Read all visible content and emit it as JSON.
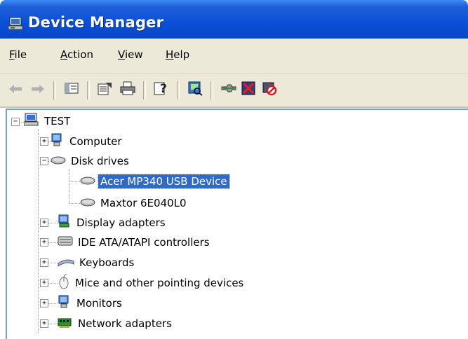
{
  "window": {
    "title": "Device Manager"
  },
  "menu": {
    "items": [
      "File",
      "Action",
      "View",
      "Help"
    ]
  },
  "toolbar": {
    "buttons": [
      "back-arrow-icon",
      "forward-arrow-icon",
      "show-hide-console-tree-icon",
      "properties-icon",
      "print-icon",
      "help-icon",
      "scan-hardware-icon",
      "update-driver-icon",
      "uninstall-icon",
      "disable-icon"
    ]
  },
  "tree": {
    "root": "TEST",
    "nodes": [
      {
        "label": "Computer"
      },
      {
        "label": "Disk drives"
      },
      {
        "label": "Acer  MP340  USB Device"
      },
      {
        "label": "Maxtor 6E040L0"
      },
      {
        "label": "Display adapters"
      },
      {
        "label": "IDE ATA/ATAPI controllers"
      },
      {
        "label": "Keyboards"
      },
      {
        "label": "Mice and other pointing devices"
      },
      {
        "label": "Monitors"
      },
      {
        "label": "Network adapters"
      }
    ]
  },
  "colors": {
    "titlebar": "#0a4fd6",
    "selection": "#316ac5",
    "chrome": "#ece9d8"
  }
}
